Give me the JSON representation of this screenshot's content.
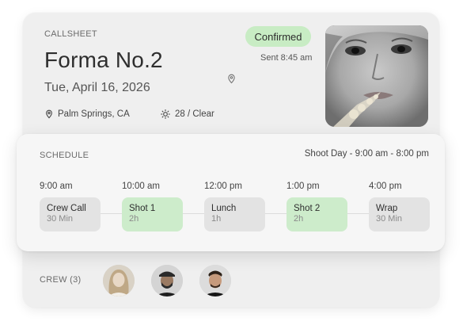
{
  "header": {
    "section_label": "CALLSHEET",
    "title": "Forma No.2",
    "date": "Tue, April 16, 2026",
    "location": "Palm Springs, CA",
    "weather": "28 / Clear",
    "status": "Confirmed",
    "sent": "Sent 8:45 am"
  },
  "schedule": {
    "label": "SCHEDULE",
    "shoot_day": "Shoot Day - 9:00 am - 8:00 pm",
    "items": [
      {
        "time": "9:00 am",
        "name": "Crew Call",
        "duration": "30 Min",
        "highlight": false
      },
      {
        "time": "10:00 am",
        "name": "Shot 1",
        "duration": "2h",
        "highlight": true
      },
      {
        "time": "12:00 pm",
        "name": "Lunch",
        "duration": "1h",
        "highlight": false
      },
      {
        "time": "1:00 pm",
        "name": "Shot 2",
        "duration": "2h",
        "highlight": true
      },
      {
        "time": "4:00 pm",
        "name": "Wrap",
        "duration": "30 Min",
        "highlight": false
      }
    ]
  },
  "crew": {
    "label": "CREW (3)"
  },
  "colors": {
    "highlight": "#cdeccb",
    "badge": "#c8ecc4",
    "event_default": "#e3e3e3"
  }
}
